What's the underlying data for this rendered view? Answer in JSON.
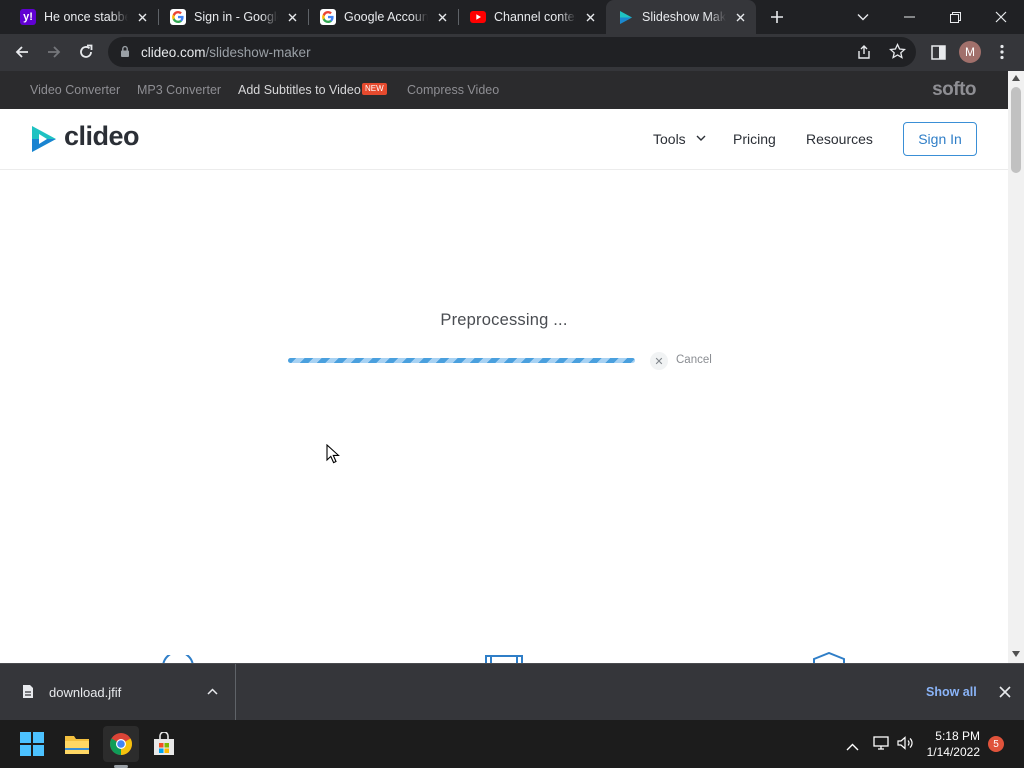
{
  "browser": {
    "tabs": [
      {
        "title": "He once stabbed",
        "favicon": "yahoo-icon"
      },
      {
        "title": "Sign in - Google",
        "favicon": "google-icon"
      },
      {
        "title": "Google Account",
        "favicon": "google-icon"
      },
      {
        "title": "Channel content",
        "favicon": "youtube-icon"
      },
      {
        "title": "Slideshow Maker",
        "favicon": "clideo-icon",
        "active": true
      }
    ],
    "url_host": "clideo.com",
    "url_path": "/slideshow-maker",
    "profile_initial": "M"
  },
  "softo_bar": {
    "links": [
      "Video Converter",
      "MP3 Converter",
      "Add Subtitles to Video",
      "Compress Video"
    ],
    "new_badge": "NEW",
    "brand": "softo"
  },
  "header": {
    "logo_text": "clideo",
    "nav": {
      "tools": "Tools",
      "pricing": "Pricing",
      "resources": "Resources"
    },
    "sign_in": "Sign In"
  },
  "main": {
    "status": "Preprocessing ...",
    "progress": 1.0,
    "cancel_label": "Cancel"
  },
  "download_shelf": {
    "file_name": "download.jfif",
    "show_all": "Show all"
  },
  "taskbar": {
    "time": "5:18 PM",
    "date": "1/14/2022",
    "notifications": "5"
  },
  "colors": {
    "accent": "#2f7ec7",
    "progress": "#4aa0de",
    "clideo_teal": "#1fc2c2",
    "clideo_blue": "#1a6fd6"
  }
}
